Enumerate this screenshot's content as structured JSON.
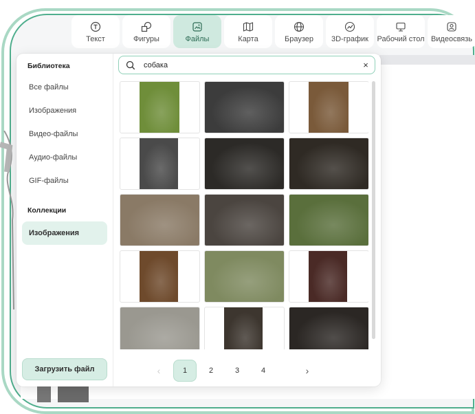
{
  "toolbar": {
    "items": [
      {
        "label": "Текст",
        "icon": "text-icon",
        "active": false
      },
      {
        "label": "Фигуры",
        "icon": "shapes-icon",
        "active": false
      },
      {
        "label": "Файлы",
        "icon": "files-icon",
        "active": true
      },
      {
        "label": "Карта",
        "icon": "map-icon",
        "active": false
      },
      {
        "label": "Браузер",
        "icon": "globe-icon",
        "active": false
      },
      {
        "label": "3D-график",
        "icon": "chart-icon",
        "active": false
      },
      {
        "label": "Рабочий стол",
        "icon": "monitor-icon",
        "active": false
      },
      {
        "label": "Видеосвязь",
        "icon": "video-call-icon",
        "active": false
      }
    ]
  },
  "sidebar": {
    "library_heading": "Библиотека",
    "library_items": [
      "Все файлы",
      "Изображения",
      "Видео-файлы",
      "Аудио-файлы",
      "GIF-файлы"
    ],
    "collections_heading": "Коллекции",
    "collection_items": [
      "Изображения"
    ],
    "active_item": "Изображения",
    "upload_button": "Загрузить файл"
  },
  "search": {
    "value": "собака",
    "clear_label": "×"
  },
  "results": {
    "thumbnails": [
      {
        "name": "dog-in-garden",
        "fill": "#6f8e3a"
      },
      {
        "name": "dog-dark-mono",
        "fill": "#3c3c3c"
      },
      {
        "name": "dog-standing-leash",
        "fill": "#7a5a3a"
      },
      {
        "name": "man-with-dog-bw",
        "fill": "#4a4a4a"
      },
      {
        "name": "french-bulldog-shadow",
        "fill": "#2c2a27"
      },
      {
        "name": "french-bulldog-light",
        "fill": "#2f2a24"
      },
      {
        "name": "pomeranian-street",
        "fill": "#8a7a66"
      },
      {
        "name": "shepherd-lying",
        "fill": "#4b4540"
      },
      {
        "name": "pomeranian-grass",
        "fill": "#5a6f3c"
      },
      {
        "name": "dog-rolling-wood",
        "fill": "#6e4a2c"
      },
      {
        "name": "husky-closeup",
        "fill": "#7f8a60"
      },
      {
        "name": "retriever-portrait",
        "fill": "#4a2a26"
      },
      {
        "name": "dog-on-gravel",
        "fill": "#9a9890"
      },
      {
        "name": "bulldog-standing",
        "fill": "#3d362f"
      },
      {
        "name": "bulldog-sneakers",
        "fill": "#2b2724"
      }
    ]
  },
  "pagination": {
    "prev": "‹",
    "pages": [
      "1",
      "2",
      "3",
      "4"
    ],
    "current": "1",
    "next": "›"
  }
}
